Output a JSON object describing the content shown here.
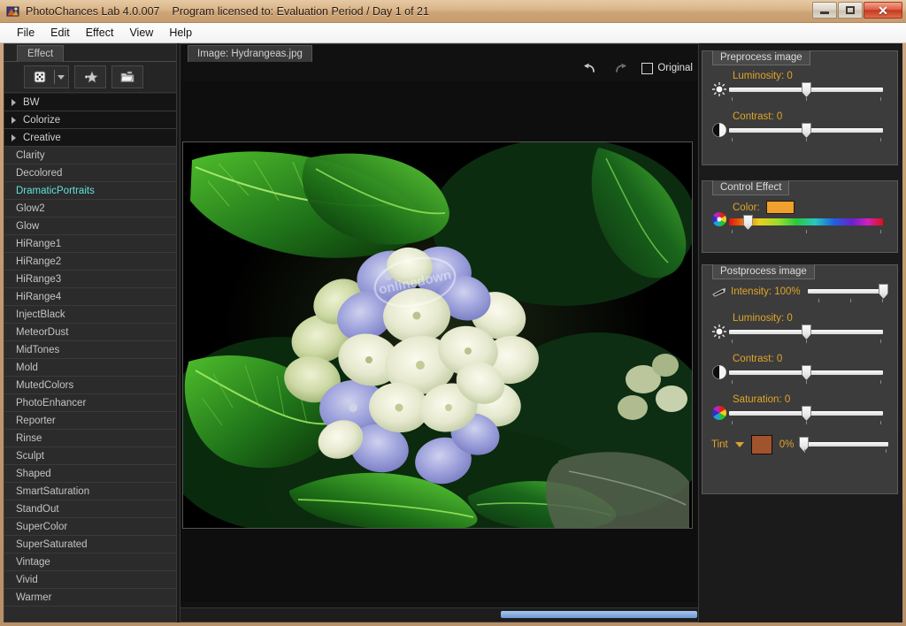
{
  "window": {
    "app_title": "PhotoChances Lab 4.0.007",
    "license_text": "Program licensed to: Evaluation Period / Day 1 of 21",
    "icon": "app-logo-icon",
    "controls": {
      "minimize": "minimize-button",
      "maximize": "maximize-button",
      "close_glyph": "✕"
    }
  },
  "menubar": {
    "items": [
      "File",
      "Edit",
      "Effect",
      "View",
      "Help"
    ]
  },
  "effect_panel": {
    "tab_label": "Effect",
    "toolbar": {
      "random_icon": "dice-icon",
      "random_dropdown_icon": "chevron-down-icon",
      "favorite_icon": "star-icon",
      "open_icon": "folder-icon"
    },
    "categories": [
      {
        "label": "BW"
      },
      {
        "label": "Colorize"
      },
      {
        "label": "Creative"
      }
    ],
    "effects": [
      {
        "label": "Clarity",
        "selected": false
      },
      {
        "label": "Decolored",
        "selected": false
      },
      {
        "label": "DramaticPortraits",
        "selected": true
      },
      {
        "label": "Glow2",
        "selected": false
      },
      {
        "label": "Glow",
        "selected": false
      },
      {
        "label": "HiRange1",
        "selected": false
      },
      {
        "label": "HiRange2",
        "selected": false
      },
      {
        "label": "HiRange3",
        "selected": false
      },
      {
        "label": "HiRange4",
        "selected": false
      },
      {
        "label": "InjectBlack",
        "selected": false
      },
      {
        "label": "MeteorDust",
        "selected": false
      },
      {
        "label": "MidTones",
        "selected": false
      },
      {
        "label": "Mold",
        "selected": false
      },
      {
        "label": "MutedColors",
        "selected": false
      },
      {
        "label": "PhotoEnhancer",
        "selected": false
      },
      {
        "label": "Reporter",
        "selected": false
      },
      {
        "label": "Rinse",
        "selected": false
      },
      {
        "label": "Sculpt",
        "selected": false
      },
      {
        "label": "Shaped",
        "selected": false
      },
      {
        "label": "SmartSaturation",
        "selected": false
      },
      {
        "label": "StandOut",
        "selected": false
      },
      {
        "label": "SuperColor",
        "selected": false
      },
      {
        "label": "SuperSaturated",
        "selected": false
      },
      {
        "label": "Vintage",
        "selected": false
      },
      {
        "label": "Vivid",
        "selected": false
      },
      {
        "label": "Warmer",
        "selected": false
      }
    ],
    "selected_color": "#5fe3d8"
  },
  "image_panel": {
    "tab_label": "Image: Hydrangeas.jpg",
    "undo_icon": "undo-arrow-icon",
    "redo_icon": "redo-arrow-icon",
    "original_checkbox_label": "Original",
    "original_checked": false,
    "photo_alt": "Hydrangea flowers with green leaves",
    "watermark": "onlinedown"
  },
  "preprocess": {
    "title": "Preprocess image",
    "controls": [
      {
        "label": "Luminosity: 0",
        "value": 0,
        "thumb_pct": 50,
        "icon": "sun-icon"
      },
      {
        "label": "Contrast: 0",
        "value": 0,
        "thumb_pct": 50,
        "icon": "contrast-icon"
      }
    ]
  },
  "control_effect": {
    "title": "Control Effect",
    "color_label": "Color:",
    "color_value": "#f0a02c",
    "icon": "color-wheel-icon",
    "hue_thumb_pct": 12
  },
  "postprocess": {
    "title": "Postprocess image",
    "controls": [
      {
        "label": "Intensity: 100%",
        "value": 100,
        "thumb_pct": 100,
        "icon": "intensity-icon",
        "inline": true
      },
      {
        "label": "Luminosity: 0",
        "value": 0,
        "thumb_pct": 50,
        "icon": "sun-icon",
        "inline": false
      },
      {
        "label": "Contrast: 0",
        "value": 0,
        "thumb_pct": 50,
        "icon": "contrast-icon",
        "inline": false
      },
      {
        "label": "Saturation: 0",
        "value": 0,
        "thumb_pct": 50,
        "icon": "color-wheel-icon",
        "inline": false
      }
    ],
    "tint": {
      "label": "Tint",
      "dropdown_icon": "chevron-down-icon",
      "swatch_color": "#a0542e",
      "percent": "0%",
      "thumb_pct": 3
    }
  },
  "colors": {
    "accent_label": "#e0a429",
    "panel_bg": "#3c3c3c",
    "list_bg": "#2b2b2b",
    "scroll_thumb": "#6f99d4"
  }
}
